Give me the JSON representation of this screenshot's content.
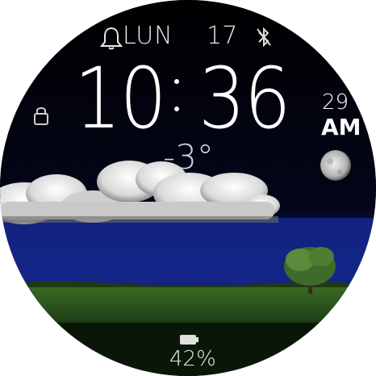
{
  "status": {
    "alarm_icon": "bell-icon",
    "day": "LUN",
    "date": "17",
    "bluetooth_icon": "bluetooth-off-icon",
    "lock_icon": "lock-icon"
  },
  "time": {
    "hour": "10",
    "minute": "36",
    "seconds": "29",
    "ampm": "AM"
  },
  "weather": {
    "temperature": "-3°",
    "moon_icon": "moon-icon"
  },
  "battery": {
    "icon": "battery-icon",
    "level_text": "42%",
    "level": 0.42
  },
  "colors": {
    "text": "#ffffff",
    "sky_night": "#0a1a66",
    "grass": "#2f5a1e"
  }
}
